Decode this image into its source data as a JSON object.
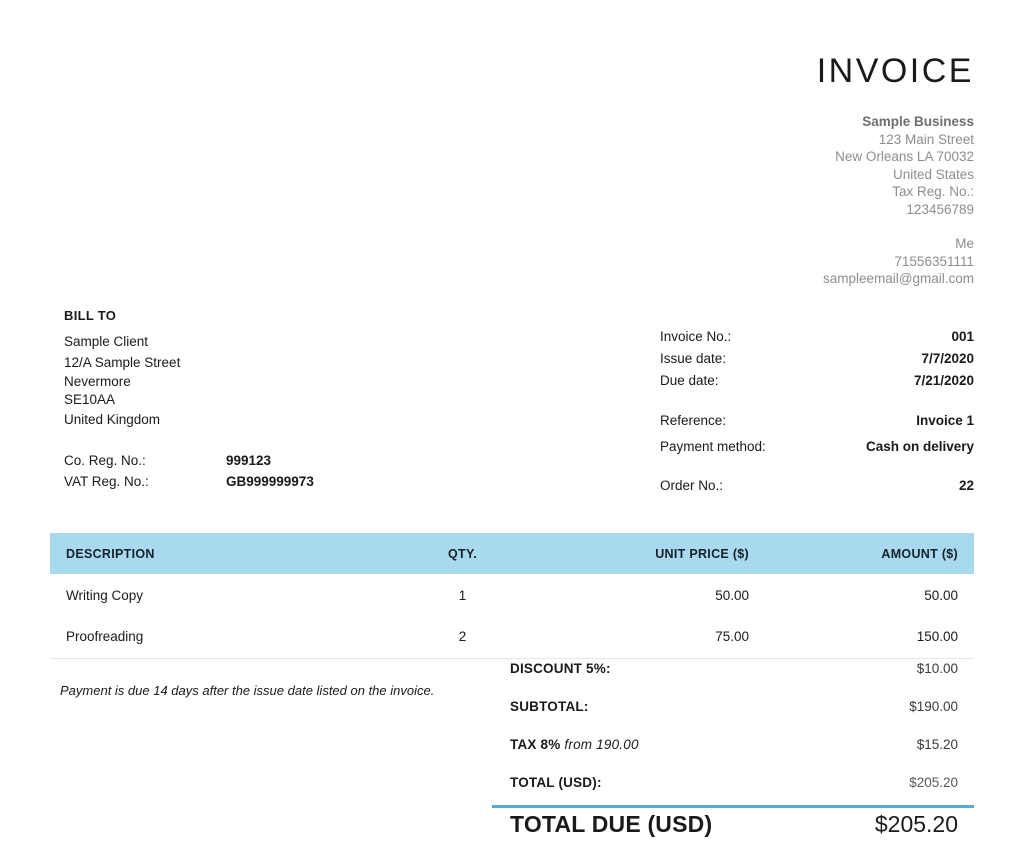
{
  "document": {
    "title": "INVOICE"
  },
  "company": {
    "name": "Sample Business",
    "street": "123 Main Street",
    "city_state_zip": "New Orleans LA 70032",
    "country": "United States",
    "tax_reg_label": "Tax Reg. No.:",
    "tax_reg_number": "123456789",
    "contact_name": "Me",
    "phone": "71556351111",
    "email": "sampleemail@gmail.com"
  },
  "bill_to": {
    "label": "BILL TO",
    "client_name": "Sample Client",
    "street": "12/A Sample Street",
    "city": "Nevermore",
    "postcode": "SE10AA",
    "country": "United Kingdom",
    "co_reg_label": "Co. Reg. No.:",
    "co_reg_value": "999123",
    "vat_reg_label": "VAT Reg. No.:",
    "vat_reg_value": "GB999999973"
  },
  "meta": {
    "invoice_no_label": "Invoice No.:",
    "invoice_no_value": "001",
    "issue_date_label": "Issue date:",
    "issue_date_value": "7/7/2020",
    "due_date_label": "Due date:",
    "due_date_value": "7/21/2020",
    "reference_label": "Reference:",
    "reference_value": "Invoice 1",
    "payment_method_label": "Payment method:",
    "payment_method_value": "Cash on delivery",
    "order_no_label": "Order No.:",
    "order_no_value": "22"
  },
  "items_table": {
    "headers": {
      "description": "DESCRIPTION",
      "qty": "QTY.",
      "unit_price": "UNIT PRICE ($)",
      "amount": "AMOUNT ($)"
    },
    "rows": [
      {
        "description": "Writing Copy",
        "qty": "1",
        "unit_price": "50.00",
        "amount": "50.00"
      },
      {
        "description": "Proofreading",
        "qty": "2",
        "unit_price": "75.00",
        "amount": "150.00"
      }
    ]
  },
  "note": {
    "text": "Payment is due 14 days after the issue date listed on the invoice."
  },
  "totals": {
    "discount_label": "DISCOUNT 5%:",
    "discount_value": "$10.00",
    "subtotal_label": "SUBTOTAL:",
    "subtotal_value": "$190.00",
    "tax_label_bold": "TAX 8%",
    "tax_label_italic": " from 190.00",
    "tax_value": "$15.20",
    "total_label": "TOTAL (USD):",
    "total_value": "$205.20",
    "grand_total_label": "TOTAL DUE (USD)",
    "grand_total_value": "$205.20"
  },
  "colors": {
    "table_header_bg": "#a8d9ef",
    "accent_rule": "#5aa8d6",
    "muted_text": "#8d8d8d",
    "row_divider": "#e6e6e6"
  }
}
